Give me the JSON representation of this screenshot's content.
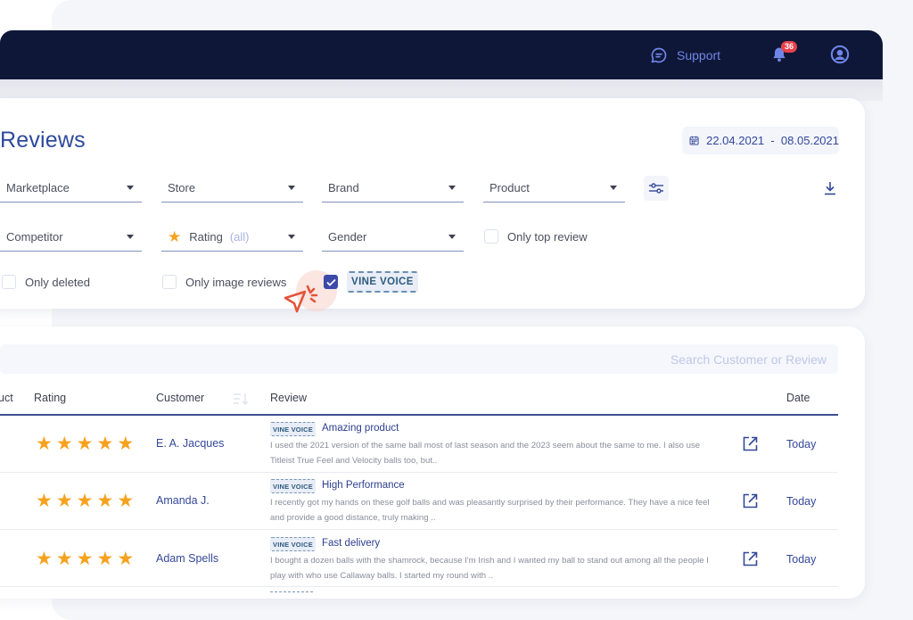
{
  "topbar": {
    "support_label": "Support",
    "notification_count": "36"
  },
  "page": {
    "title": "Reviews",
    "date_range": "22.04.2021  -  08.05.2021"
  },
  "filters": {
    "selects": [
      {
        "label": "Marketplace"
      },
      {
        "label": "Store"
      },
      {
        "label": "Brand"
      },
      {
        "label": "Product"
      },
      {
        "label": "Competitor"
      },
      {
        "label": "Rating",
        "value": "(all)"
      },
      {
        "label": "Gender"
      }
    ],
    "checkboxes": [
      {
        "label": "Only top review",
        "checked": false
      },
      {
        "label": "Only deleted",
        "checked": false
      },
      {
        "label": "Only image reviews",
        "checked": false
      },
      {
        "label": "VINE VOICE",
        "checked": true
      }
    ]
  },
  "table": {
    "search_placeholder": "Search Customer or Review",
    "columns": [
      "uct",
      "Rating",
      "Customer",
      "Review",
      "Date"
    ],
    "vine_label": "VINE VOICE",
    "rows": [
      {
        "rating": 5,
        "customer": "E. A. Jacques",
        "title": "Amazing product",
        "body": "I used the 2021 version of the same ball most of last season and the 2023 seem about the same to me. I also use Titleist True Feel and Velocity balls too, but..",
        "date": "Today"
      },
      {
        "rating": 5,
        "customer": "Amanda J.",
        "title": "High Performance",
        "body": "I recently got my hands on these golf balls and was pleasantly surprised by their performance. They have a nice feel and provide a good distance, truly making ..",
        "date": "Today"
      },
      {
        "rating": 5,
        "customer": "Adam Spells",
        "title": "Fast delivery",
        "body": "I bought a dozen balls with the shamrock, because I'm Irish and I wanted my ball to stand out among all the people I play with who use Callaway balls. I started my round with ..",
        "date": "Today"
      }
    ]
  },
  "colors": {
    "topbar": "#0f1738",
    "accent": "#2d4a9c",
    "star": "#f6a21e",
    "badge": "#e8424a"
  }
}
